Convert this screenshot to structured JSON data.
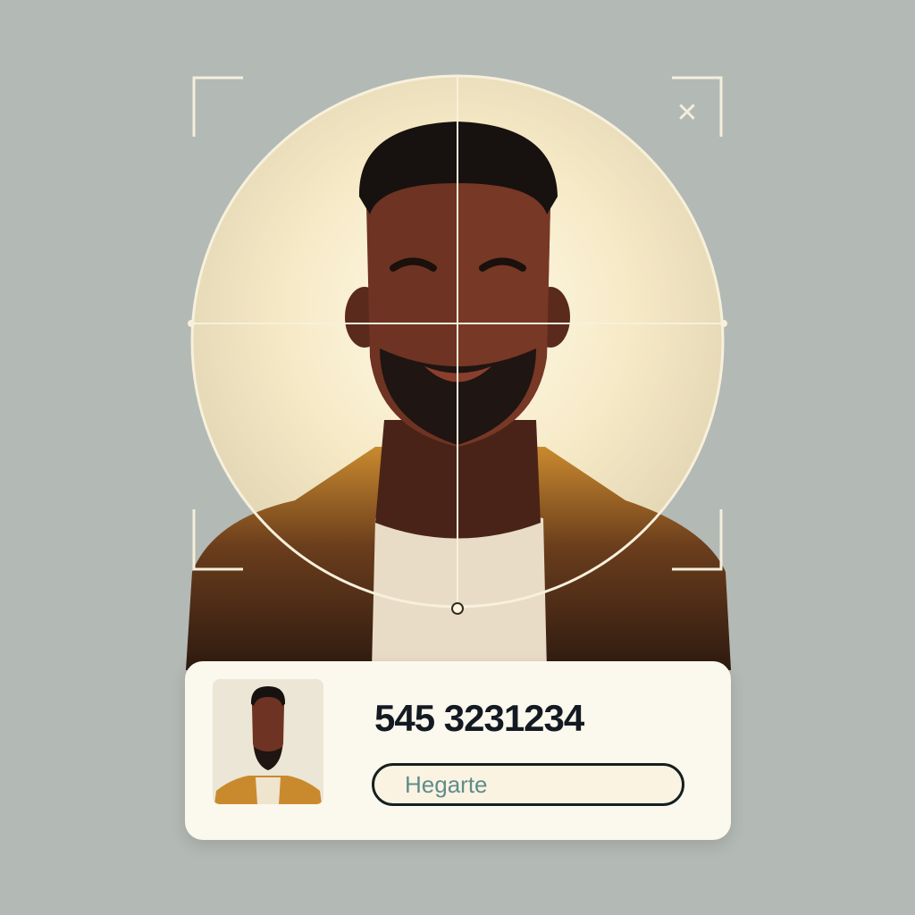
{
  "card": {
    "phone_number": "545 3231234",
    "name_field": {
      "value": "Hegarte"
    }
  },
  "icons": {
    "close": "close-icon"
  },
  "colors": {
    "background": "#b3b9b4",
    "card": "#fbf8ee",
    "frame": "#f5eedb",
    "jacket": "#c98a2e"
  }
}
